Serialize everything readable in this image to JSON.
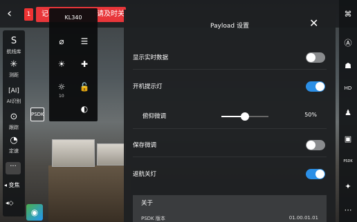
{
  "topbar": {
    "back_icon": "chevron-left-icon",
    "badge": "1",
    "alert_left": "记",
    "alert_right": "请及时关"
  },
  "left_rail": {
    "items": [
      {
        "label": "航线库",
        "icon": "route-icon"
      },
      {
        "label": "测距",
        "icon": "laser-icon"
      },
      {
        "label": "AI识别",
        "icon": "ai-icon"
      },
      {
        "label": "跟踪",
        "icon": "target-icon"
      },
      {
        "label": "定速",
        "icon": "speed-icon"
      }
    ],
    "more": "···",
    "zoom_label": "◂ 变焦",
    "psdk_label": "PSDK"
  },
  "popover": {
    "title": "KL340",
    "brightness_value": "10"
  },
  "panel": {
    "title": "Payload 设置",
    "rows": [
      {
        "label": "显示实时数据",
        "state": "off"
      },
      {
        "label": "开机提示灯",
        "state": "on"
      },
      {
        "label": "俯仰微调",
        "value": "50%",
        "level": 0.5
      },
      {
        "label": "保存微调",
        "state": "off"
      },
      {
        "label": "返航关灯",
        "state": "on"
      }
    ],
    "about": {
      "title": "关于",
      "key": "PSDK 版本",
      "value": "01.00.01.01"
    }
  },
  "right_rail": {
    "icons": [
      "drone-icon",
      "a-icon",
      "robot-icon",
      "hd-icon",
      "person-icon",
      "camera-icon",
      "psdk-icon",
      "satellite-icon",
      "more-icon"
    ],
    "hd_label": "HD",
    "psdk_label": "PSDK"
  }
}
